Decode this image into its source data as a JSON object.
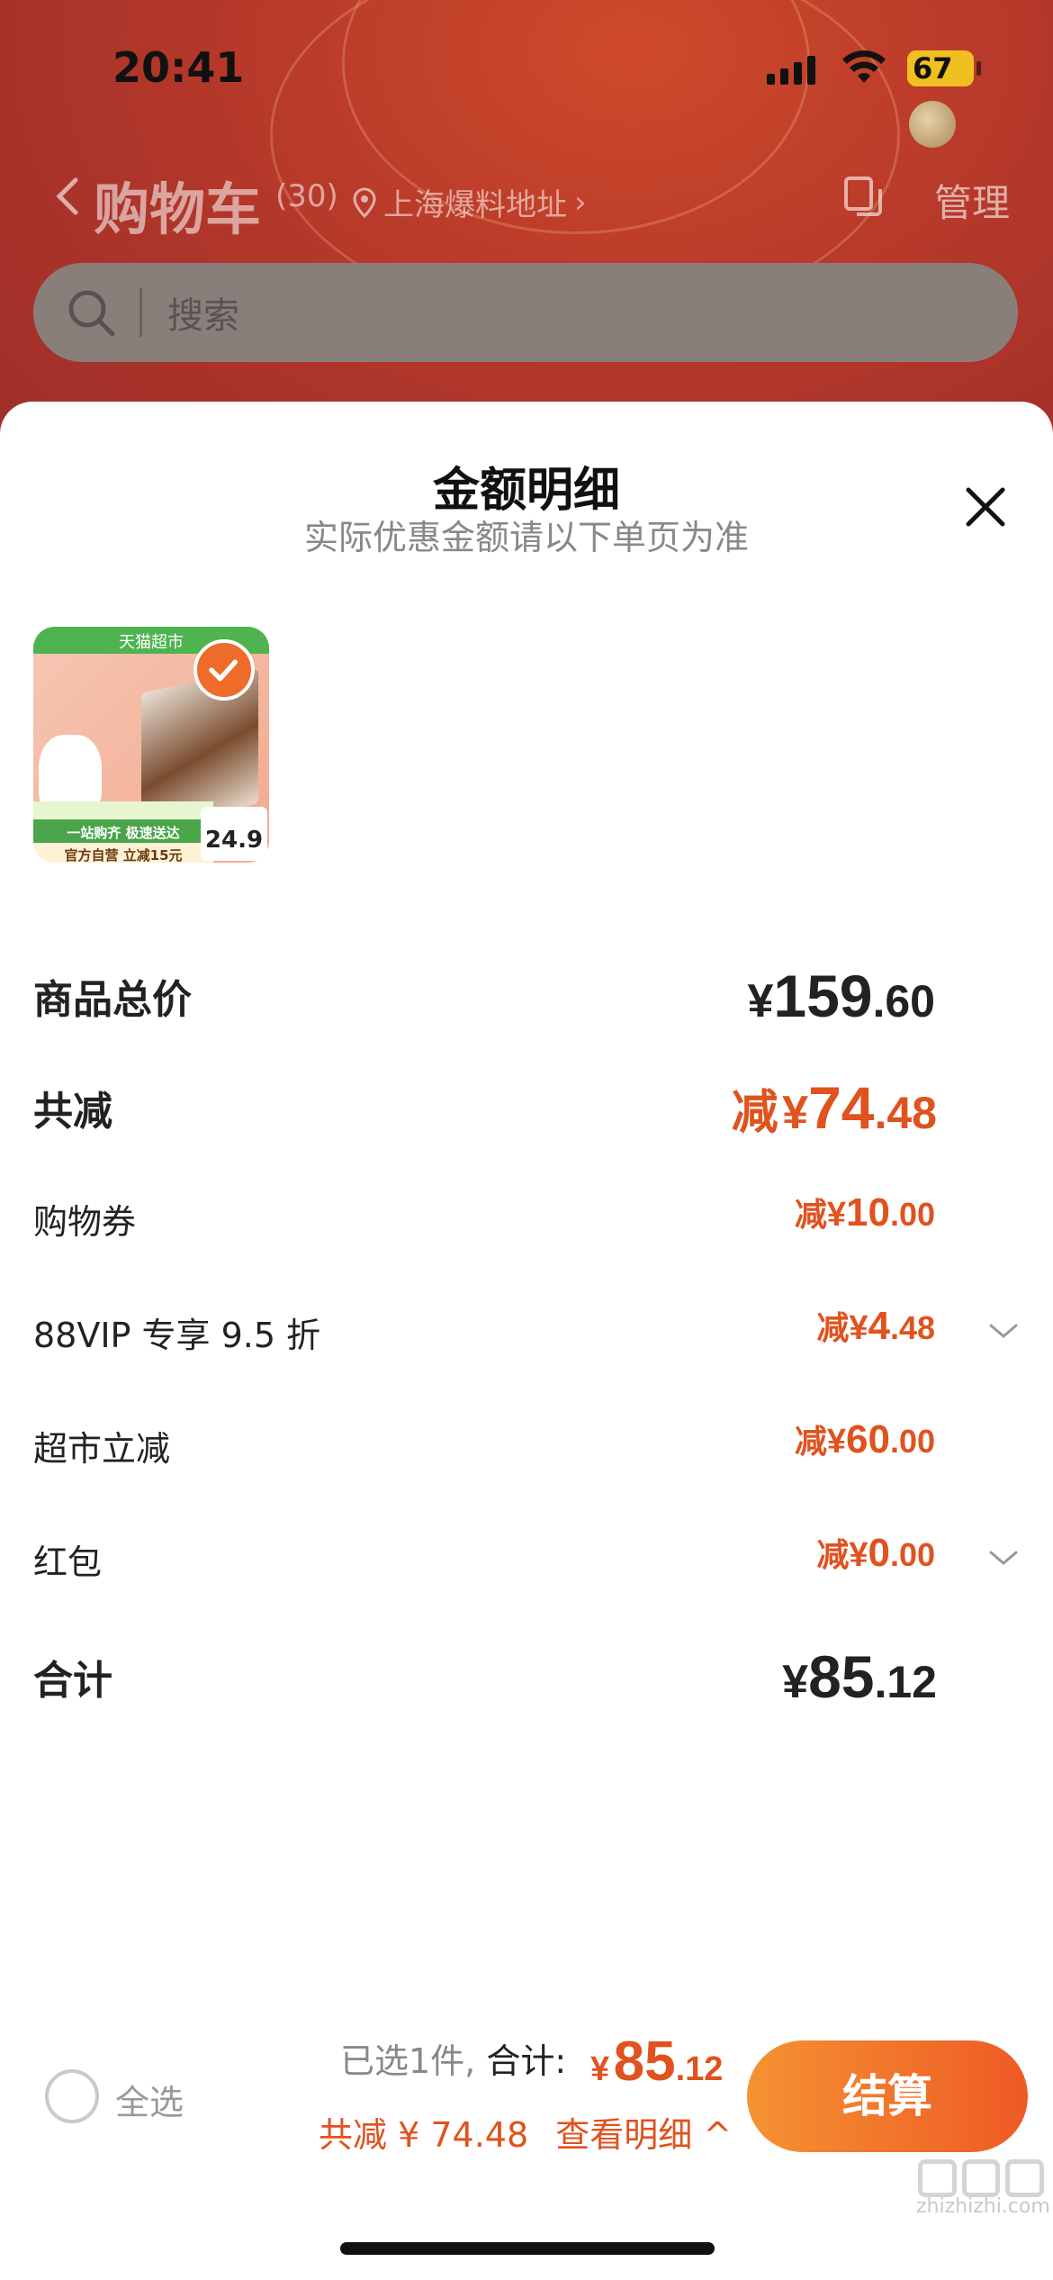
{
  "status": {
    "time": "20:41",
    "battery": "67"
  },
  "nav": {
    "title": "购物车",
    "count": "(30)",
    "location": "上海爆料地址",
    "manage": "管理"
  },
  "search": {
    "placeholder": "搜索"
  },
  "sheet": {
    "title": "金额明细",
    "subtitle": "实际优惠金额请以下单页为准",
    "product": {
      "top_label": "天猫超市",
      "band_line": "一站购齐 极速送达",
      "band_promo": "官方自营 立减15元",
      "price": "24.9"
    },
    "rows": [
      {
        "label": "商品总价",
        "prefix": "",
        "yen": "¥",
        "int": "159",
        "dec": ".60"
      },
      {
        "label": "共减",
        "prefix": "减",
        "yen": "¥",
        "int": "74",
        "dec": ".48"
      },
      {
        "label": "购物券",
        "prefix": "减",
        "yen": "¥",
        "int": "10",
        "dec": ".00"
      },
      {
        "label": "88VIP 专享 9.5 折",
        "prefix": "减",
        "yen": "¥",
        "int": "4",
        "dec": ".48"
      },
      {
        "label": "超市立减",
        "prefix": "减",
        "yen": "¥",
        "int": "60",
        "dec": ".00"
      },
      {
        "label": "红包",
        "prefix": "减",
        "yen": "¥",
        "int": "0",
        "dec": ".00"
      },
      {
        "label": "合计",
        "prefix": "",
        "yen": "¥",
        "int": "85",
        "dec": ".12"
      }
    ]
  },
  "bottom": {
    "select_all": "全选",
    "selected_text": "已选1件,",
    "total_label": "合计:",
    "total_yen": "¥",
    "total_int": "85",
    "total_dec": ".12",
    "discount_text": "共减 ¥ 74.48",
    "detail_link": "查看明细 ^",
    "checkout": "结算"
  },
  "watermark": "zhizhizhi.com",
  "colors": {
    "accent": "#E0521E",
    "checkout_start": "#F59233",
    "checkout_end": "#EE5A24",
    "header_bg": "#B83A2A"
  }
}
